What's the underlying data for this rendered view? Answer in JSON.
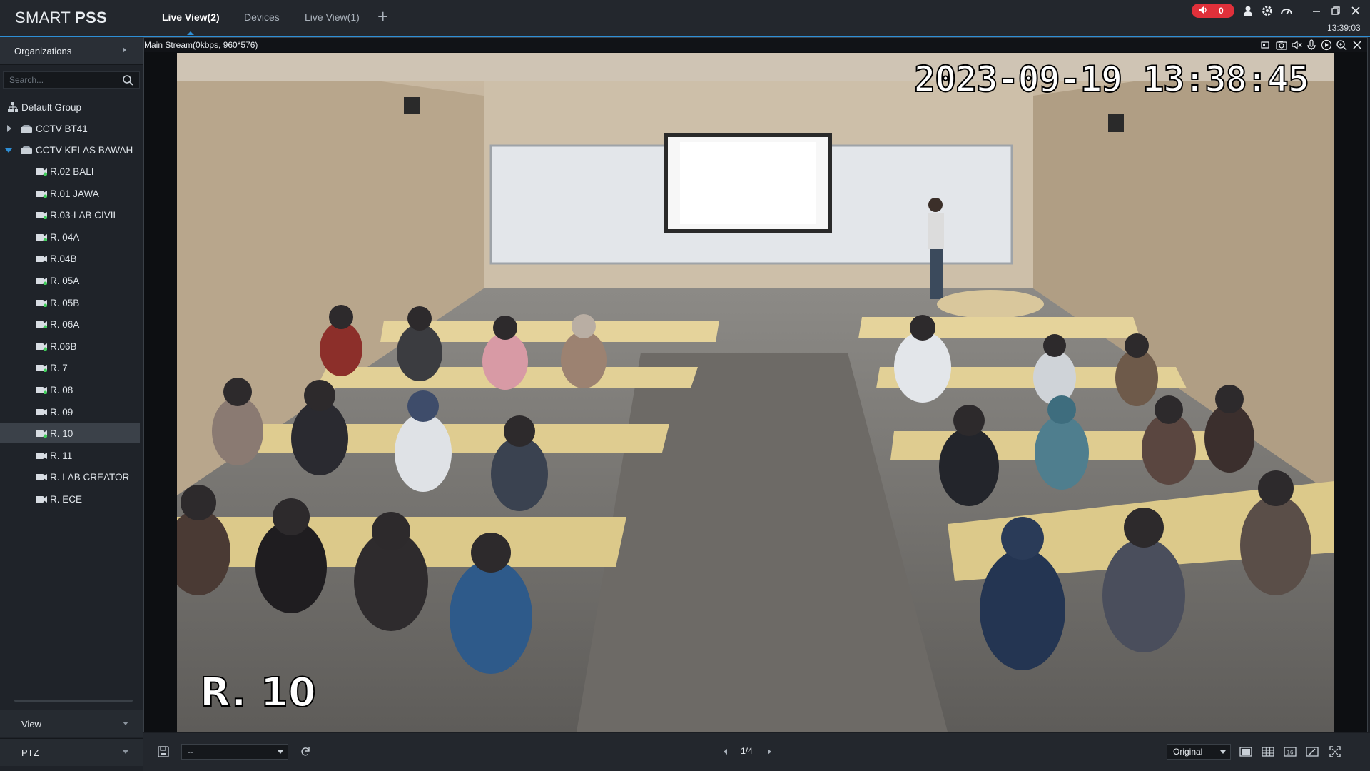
{
  "app": {
    "logo_light": "SMART ",
    "logo_bold": "PSS"
  },
  "tabs": [
    {
      "label": "Live View(2)",
      "active": true
    },
    {
      "label": "Devices",
      "active": false
    },
    {
      "label": "Live View(1)",
      "active": false
    }
  ],
  "topbar": {
    "alarm_count": "0",
    "clock": "13:39:03",
    "alarm_color": "#e0303a",
    "accent_color": "#2e8fd6",
    "icons": [
      "add-tab-icon",
      "speaker-icon",
      "user-icon",
      "settings-icon",
      "performance-icon",
      "minimize-icon",
      "restore-icon",
      "close-icon"
    ]
  },
  "sidebar": {
    "organizations_label": "Organizations",
    "search_placeholder": "Search...",
    "tree": {
      "root": "Default Group",
      "groups": [
        {
          "label": "CCTV BT41",
          "expanded": false
        },
        {
          "label": "CCTV KELAS BAWAH",
          "expanded": true
        }
      ],
      "cameras": [
        {
          "label": "R.02 BALI",
          "online": true
        },
        {
          "label": "R.01 JAWA",
          "online": true
        },
        {
          "label": "R.03-LAB CIVIL",
          "online": true
        },
        {
          "label": "R. 04A",
          "online": true
        },
        {
          "label": "R.04B",
          "online": false
        },
        {
          "label": "R. 05A",
          "online": true
        },
        {
          "label": "R. 05B",
          "online": true
        },
        {
          "label": "R. 06A",
          "online": true
        },
        {
          "label": "R.06B",
          "online": true
        },
        {
          "label": "R. 7",
          "online": true
        },
        {
          "label": "R. 08",
          "online": true
        },
        {
          "label": "R. 09",
          "online": false
        },
        {
          "label": "R. 10",
          "online": true,
          "selected": true
        },
        {
          "label": "R. 11",
          "online": false
        },
        {
          "label": "R. LAB CREATOR",
          "online": false
        },
        {
          "label": "R. ECE",
          "online": false
        }
      ]
    },
    "view_label": "View",
    "ptz_label": "PTZ"
  },
  "video": {
    "stream_info": "Main Stream(0kbps, 960*576)",
    "osd_timestamp": "2023-09-19 13:38:45",
    "osd_channel": "R. 10",
    "toolbar_icons": [
      "fisheye-icon",
      "snapshot-icon",
      "audio-icon",
      "talk-icon",
      "record-icon",
      "zoom-icon",
      "close-video-icon"
    ]
  },
  "bottombar": {
    "preset_value": "--",
    "page_indicator": "1/4",
    "ratio_value": "Original",
    "icons": [
      "save-view-icon",
      "refresh-icon",
      "layout-1-icon",
      "layout-4-icon",
      "layout-16-icon",
      "custom-layout-icon",
      "fullscreen-icon"
    ]
  }
}
